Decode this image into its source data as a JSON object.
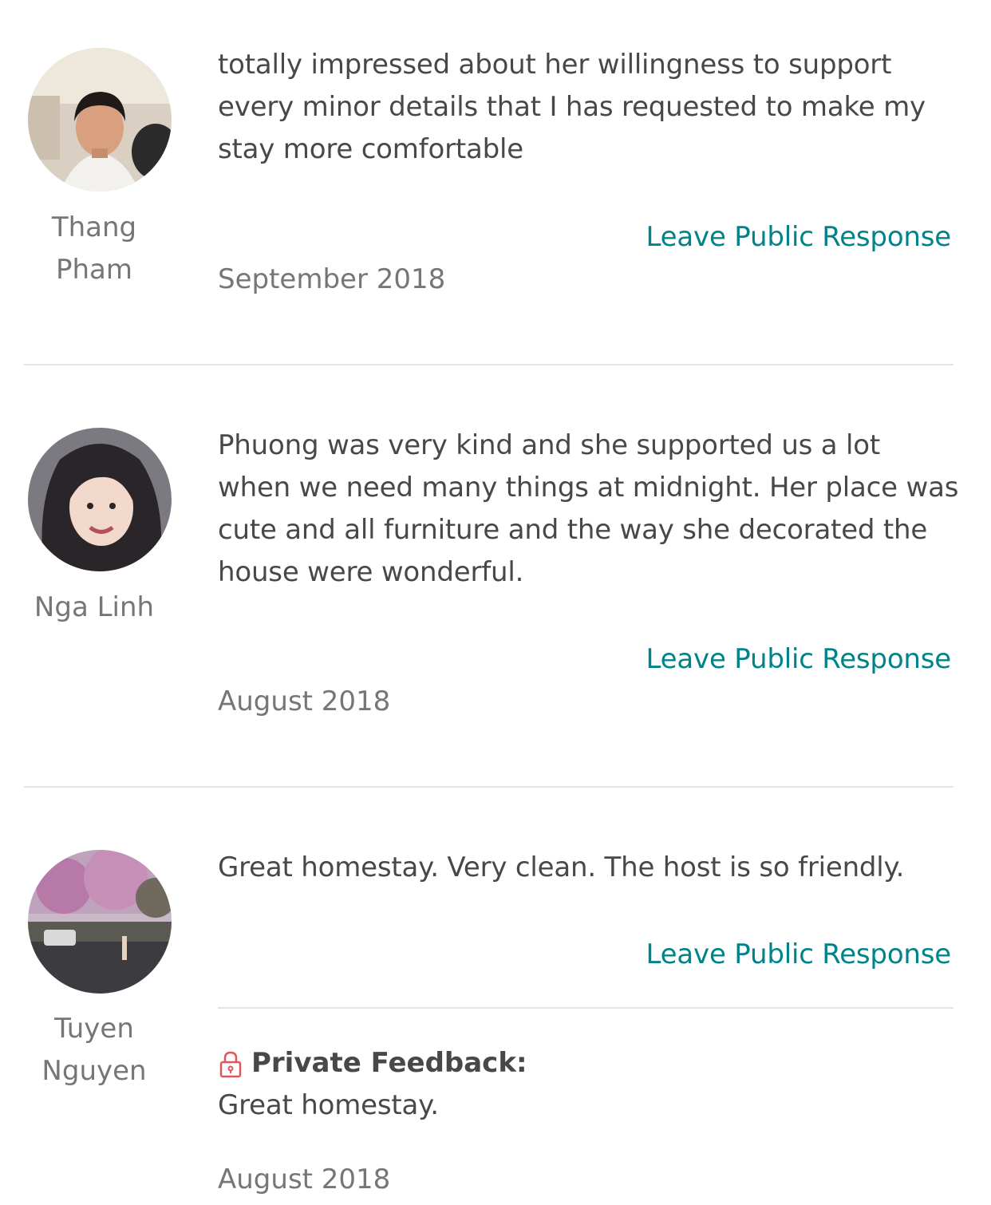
{
  "reviews": [
    {
      "reviewer": {
        "first": "Thang",
        "last": "Pham"
      },
      "text": "totally impressed about her willingness to support every minor details that I has requested to make my stay more comfortable",
      "response_label": "Leave Public Response",
      "date": "September 2018"
    },
    {
      "reviewer": {
        "first": "Nga Linh",
        "last": ""
      },
      "text": "Phuong was very kind and she supported us a lot when we need many things at midnight. Her place was cute and all furniture and the way she decorated the house were wonderful.",
      "response_label": "Leave Public Response",
      "date": "August 2018"
    },
    {
      "reviewer": {
        "first": "Tuyen",
        "last": "Nguyen"
      },
      "text": "Great homestay. Very clean. The host is so friendly.",
      "response_label": "Leave Public Response",
      "private_feedback": {
        "label": "Private Feedback:",
        "text": "Great homestay.",
        "icon": "lock-icon"
      },
      "date": "August 2018"
    }
  ],
  "colors": {
    "link": "#008489",
    "text": "#484848",
    "muted": "#767676",
    "divider": "#e4e4e4",
    "lock": "#e0565b"
  }
}
